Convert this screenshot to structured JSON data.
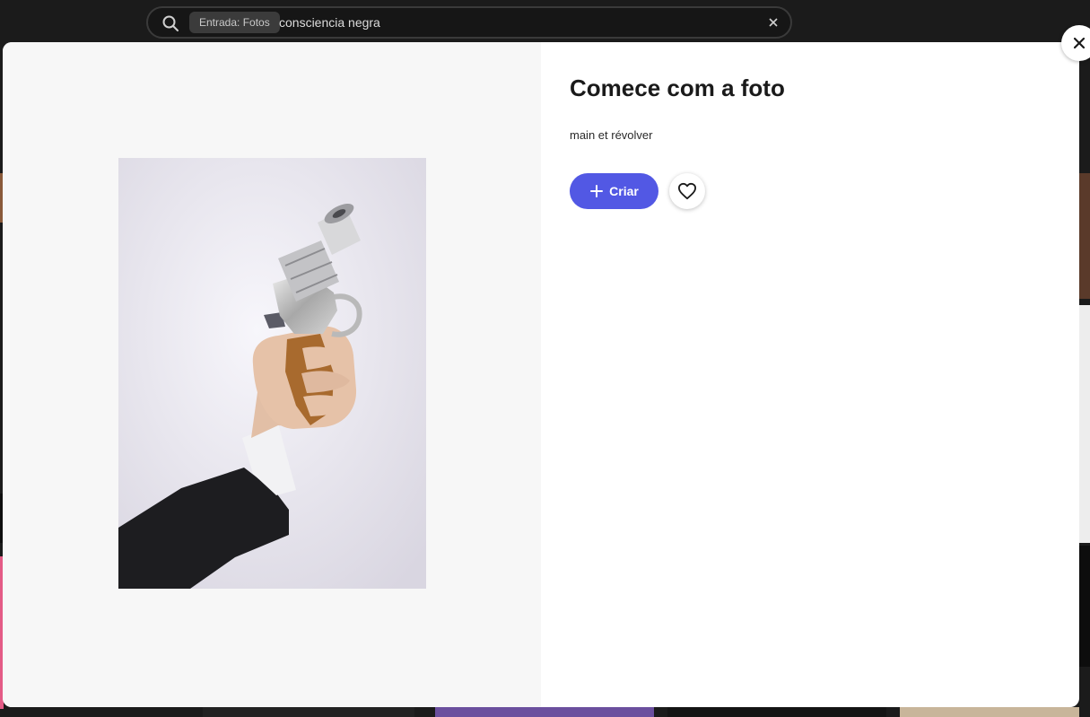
{
  "search": {
    "filter_chip": "Entrada: Fotos",
    "query": "consciencia negra"
  },
  "modal": {
    "title": "Comece com a foto",
    "description": "main et révolver",
    "create_label": "Criar",
    "icons": {
      "search": "search-icon",
      "clear": "close-icon",
      "plus": "plus-icon",
      "favorite": "heart-icon",
      "close": "close-icon"
    },
    "colors": {
      "accent": "#5258e4",
      "topbar": "#1b1b1b"
    }
  }
}
